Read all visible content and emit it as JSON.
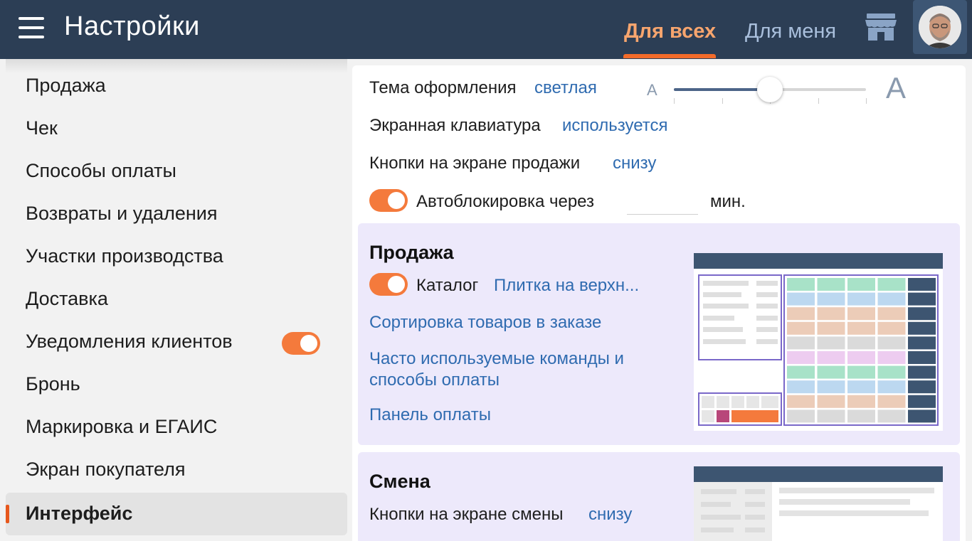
{
  "header": {
    "title": "Настройки",
    "tabs": [
      {
        "label": "Для всех",
        "active": true
      },
      {
        "label": "Для меня",
        "active": false
      }
    ],
    "accent_color": "#f26b2a",
    "bg_color": "#2c3e55",
    "icons": [
      "menu-icon",
      "store-icon",
      "avatar"
    ]
  },
  "sidebar": {
    "items": [
      {
        "label": "Продажа"
      },
      {
        "label": "Чек"
      },
      {
        "label": "Способы оплаты"
      },
      {
        "label": "Возвраты и удаления"
      },
      {
        "label": "Участки производства"
      },
      {
        "label": "Доставка"
      },
      {
        "label": "Уведомления клиентов",
        "toggle": true
      },
      {
        "label": "Бронь"
      },
      {
        "label": "Маркировка и ЕГАИС"
      },
      {
        "label": "Экран покупателя"
      },
      {
        "label": "Интерфейс",
        "active": true
      }
    ]
  },
  "general": {
    "theme_label": "Тема оформления",
    "theme_value": "светлая",
    "font_scale": {
      "min_label": "A",
      "max_label": "A",
      "value_fraction": 0.5,
      "steps": 5
    },
    "keyboard_label": "Экранная клавиатура",
    "keyboard_value": "используется",
    "sale_buttons_label": "Кнопки на экране продажи",
    "sale_buttons_value": "снизу",
    "autolock_label": "Автоблокировка через",
    "autolock_enabled": true,
    "autolock_value": "",
    "autolock_unit": "мин."
  },
  "sale_card": {
    "title": "Продажа",
    "catalog_label": "Каталог",
    "catalog_enabled": true,
    "catalog_value": "Плитка на верхн...",
    "sort_link": "Сортировка товаров в заказе",
    "commands_link_line1": "Часто используемые команды и",
    "commands_link_line2": "способы оплаты",
    "payment_panel_link": "Панель оплаты",
    "bg_color": "#ede9fb"
  },
  "shift_card": {
    "title": "Смена",
    "buttons_label": "Кнопки на экране смены",
    "buttons_value": "снизу"
  }
}
